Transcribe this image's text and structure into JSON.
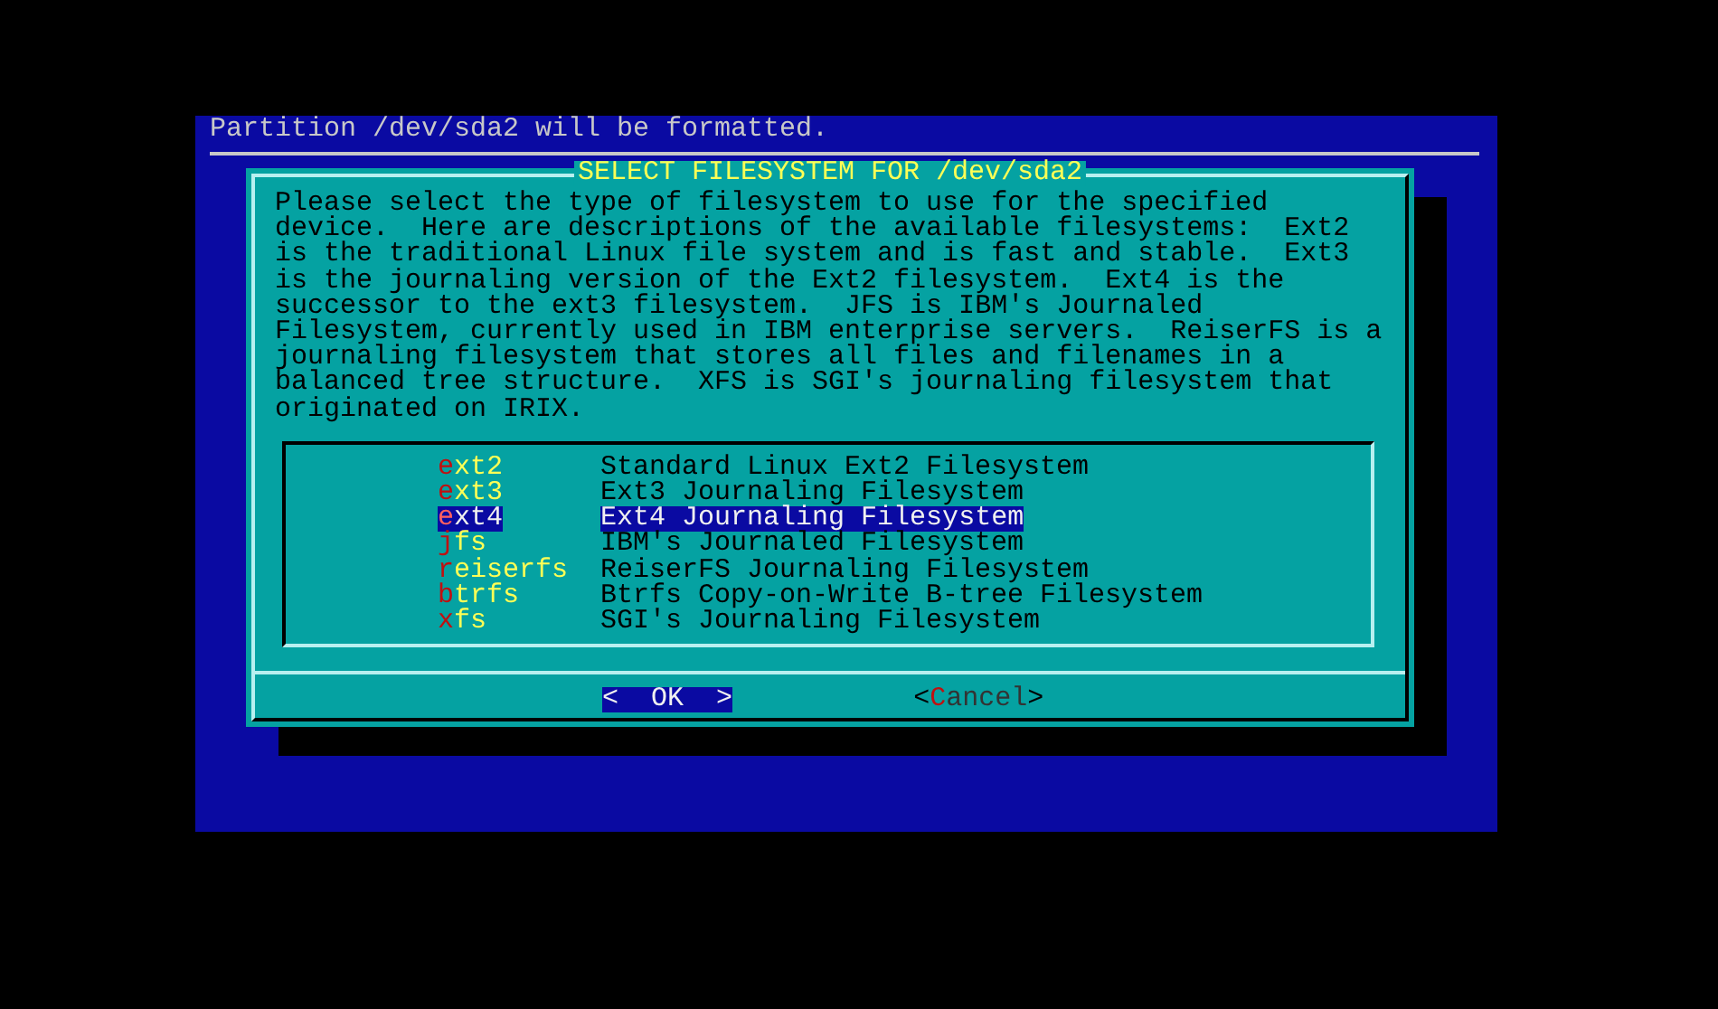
{
  "status_message": "Partition /dev/sda2 will be formatted.",
  "dialog": {
    "title": "SELECT FILESYSTEM FOR /dev/sda2",
    "description": "Please select the type of filesystem to use for the specified\ndevice.  Here are descriptions of the available filesystems:  Ext2\nis the traditional Linux file system and is fast and stable.  Ext3\nis the journaling version of the Ext2 filesystem.  Ext4 is the\nsuccessor to the ext3 filesystem.  JFS is IBM's Journaled\nFilesystem, currently used in IBM enterprise servers.  ReiserFS is a\njournaling filesystem that stores all files and filenames in a\nbalanced tree structure.  XFS is SGI's journaling filesystem that\noriginated on IRIX.",
    "items": [
      {
        "tag": "ext2",
        "description": "Standard Linux Ext2 Filesystem",
        "selected": false
      },
      {
        "tag": "ext3",
        "description": "Ext3 Journaling Filesystem",
        "selected": false
      },
      {
        "tag": "ext4",
        "description": "Ext4 Journaling Filesystem",
        "selected": true
      },
      {
        "tag": "jfs",
        "description": "IBM's Journaled Filesystem",
        "selected": false
      },
      {
        "tag": "reiserfs",
        "description": "ReiserFS Journaling Filesystem",
        "selected": false
      },
      {
        "tag": "btrfs",
        "description": "Btrfs Copy-on-Write B-tree Filesystem",
        "selected": false
      },
      {
        "tag": "xfs",
        "description": "SGI's Journaling Filesystem",
        "selected": false
      }
    ],
    "buttons": [
      {
        "open": "<",
        "label": "OK",
        "close": ">",
        "selected": true
      },
      {
        "open": "<",
        "label": "Cancel",
        "close": ">",
        "selected": false
      }
    ]
  }
}
